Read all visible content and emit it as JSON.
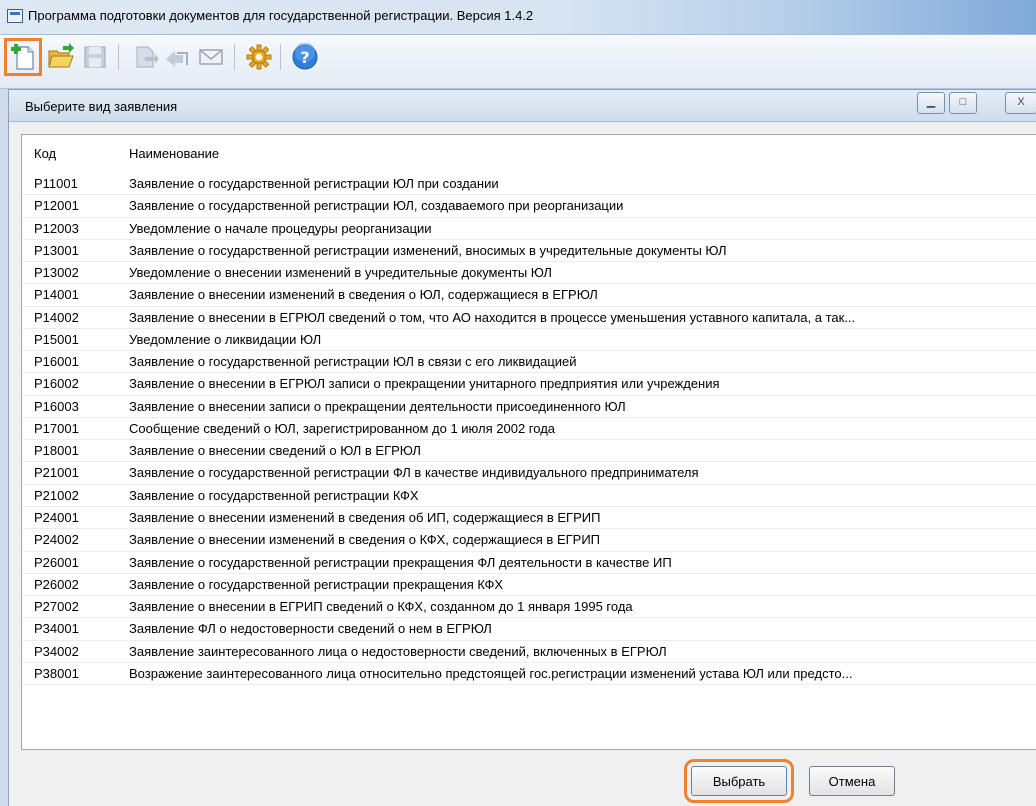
{
  "window": {
    "title": "Программа подготовки документов для государственной регистрации. Версия 1.4.2"
  },
  "toolbar": {
    "buttons": [
      {
        "icon": "new-document-icon",
        "highlighted": true,
        "enabled": true
      },
      {
        "icon": "open-folder-icon",
        "enabled": true
      },
      {
        "icon": "save-icon",
        "enabled": false
      },
      {
        "icon": "print-icon",
        "enabled": false
      },
      {
        "icon": "export-icon",
        "enabled": false
      },
      {
        "icon": "mail-icon",
        "enabled": false
      },
      {
        "icon": "settings-gear-icon",
        "enabled": true
      },
      {
        "icon": "help-icon",
        "enabled": true
      }
    ]
  },
  "dialog": {
    "title": "Выберите вид заявления",
    "columns": {
      "code": "Код",
      "name": "Наименование"
    },
    "rows": [
      {
        "code": "Р11001",
        "name": "Заявление о государственной регистрации ЮЛ при создании"
      },
      {
        "code": "Р12001",
        "name": "Заявление о государственной регистрации ЮЛ, создаваемого при реорганизации"
      },
      {
        "code": "Р12003",
        "name": "Уведомление о начале процедуры реорганизации"
      },
      {
        "code": "Р13001",
        "name": "Заявление о государственной регистрации изменений, вносимых в учредительные документы ЮЛ"
      },
      {
        "code": "Р13002",
        "name": "Уведомление о внесении изменений в учредительные документы ЮЛ"
      },
      {
        "code": "Р14001",
        "name": "Заявление о внесении изменений в сведения о ЮЛ, содержащиеся в ЕГРЮЛ"
      },
      {
        "code": "Р14002",
        "name": "Заявление о внесении в ЕГРЮЛ сведений о том, что АО находится в процессе уменьшения уставного капитала, а так..."
      },
      {
        "code": "Р15001",
        "name": "Уведомление о ликвидации ЮЛ"
      },
      {
        "code": "Р16001",
        "name": "Заявление о государственной регистрации ЮЛ в связи с его ликвидацией"
      },
      {
        "code": "Р16002",
        "name": "Заявление о внесении в ЕГРЮЛ записи о прекращении унитарного предприятия или учреждения"
      },
      {
        "code": "Р16003",
        "name": "Заявление о внесении записи о прекращении деятельности присоединенного ЮЛ"
      },
      {
        "code": "Р17001",
        "name": "Сообщение сведений о ЮЛ, зарегистрированном до 1 июля 2002 года"
      },
      {
        "code": "Р18001",
        "name": "Заявление о внесении сведений о ЮЛ в ЕГРЮЛ"
      },
      {
        "code": "Р21001",
        "name": "Заявление о государственной регистрации ФЛ в качестве индивидуального предпринимателя"
      },
      {
        "code": "Р21002",
        "name": "Заявление о государственной регистрации КФХ"
      },
      {
        "code": "Р24001",
        "name": "Заявление о внесении изменений в сведения об ИП, содержащиеся в ЕГРИП"
      },
      {
        "code": "Р24002",
        "name": "Заявление о внесении изменений в сведения о КФХ, содержащиеся в ЕГРИП"
      },
      {
        "code": "Р26001",
        "name": "Заявление о государственной регистрации прекращения ФЛ деятельности в качестве ИП"
      },
      {
        "code": "Р26002",
        "name": "Заявление о государственной регистрации прекращения КФХ"
      },
      {
        "code": "Р27002",
        "name": "Заявление о внесении в ЕГРИП сведений о КФХ, созданном до 1 января 1995 года"
      },
      {
        "code": "Р34001",
        "name": "Заявление ФЛ о недостоверности сведений о нем в ЕГРЮЛ"
      },
      {
        "code": "Р34002",
        "name": "Заявление заинтересованного лица о недостоверности сведений, включенных в ЕГРЮЛ"
      },
      {
        "code": "Р38001",
        "name": "Возражение заинтересованного лица относительно предстоящей гос.регистрации изменений устава ЮЛ или предсто..."
      }
    ],
    "buttons": {
      "select": "Выбрать",
      "cancel": "Отмена"
    },
    "window_controls": {
      "minimize": "▁",
      "maximize": "□",
      "close": "X"
    }
  },
  "colors": {
    "highlight": "#f0802c",
    "toolbar_bg": "#e3ebf5",
    "dialog_bg": "#f0f0f0"
  }
}
